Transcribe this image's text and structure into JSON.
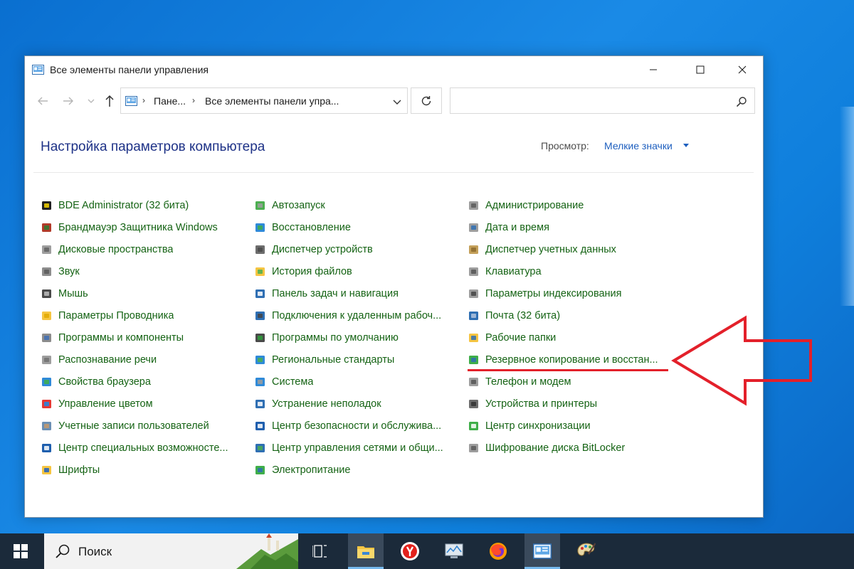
{
  "window": {
    "title": "Все элементы панели управления"
  },
  "address": {
    "crumbs": [
      "Пане...",
      "Все элементы панели упра..."
    ]
  },
  "search": {
    "placeholder": ""
  },
  "header": {
    "title": "Настройка параметров компьютера",
    "view_label": "Просмотр:",
    "view_value": "Мелкие значки"
  },
  "columns": [
    [
      {
        "label": "BDE Administrator (32 бита)",
        "icon": "bde-admin-icon"
      },
      {
        "label": "Брандмауэр Защитника Windows",
        "icon": "firewall-icon"
      },
      {
        "label": "Дисковые пространства",
        "icon": "storage-spaces-icon"
      },
      {
        "label": "Звук",
        "icon": "sound-icon"
      },
      {
        "label": "Мышь",
        "icon": "mouse-icon"
      },
      {
        "label": "Параметры Проводника",
        "icon": "explorer-options-icon"
      },
      {
        "label": "Программы и компоненты",
        "icon": "programs-icon"
      },
      {
        "label": "Распознавание речи",
        "icon": "microphone-icon"
      },
      {
        "label": "Свойства браузера",
        "icon": "internet-options-icon"
      },
      {
        "label": "Управление цветом",
        "icon": "color-management-icon"
      },
      {
        "label": "Учетные записи пользователей",
        "icon": "user-accounts-icon"
      },
      {
        "label": "Центр специальных возможносте...",
        "icon": "ease-of-access-icon"
      },
      {
        "label": "Шрифты",
        "icon": "fonts-icon"
      }
    ],
    [
      {
        "label": "Автозапуск",
        "icon": "autoplay-icon"
      },
      {
        "label": "Восстановление",
        "icon": "recovery-icon"
      },
      {
        "label": "Диспетчер устройств",
        "icon": "device-manager-icon"
      },
      {
        "label": "История файлов",
        "icon": "file-history-icon"
      },
      {
        "label": "Панель задач и навигация",
        "icon": "taskbar-icon"
      },
      {
        "label": "Подключения к удаленным рабоч...",
        "icon": "remote-connections-icon"
      },
      {
        "label": "Программы по умолчанию",
        "icon": "default-programs-icon"
      },
      {
        "label": "Региональные стандарты",
        "icon": "region-icon"
      },
      {
        "label": "Система",
        "icon": "system-icon"
      },
      {
        "label": "Устранение неполадок",
        "icon": "troubleshooting-icon"
      },
      {
        "label": "Центр безопасности и обслужива...",
        "icon": "security-flag-icon"
      },
      {
        "label": "Центр управления сетями и общи...",
        "icon": "network-center-icon"
      },
      {
        "label": "Электропитание",
        "icon": "power-options-icon"
      }
    ],
    [
      {
        "label": "Администрирование",
        "icon": "admin-tools-icon"
      },
      {
        "label": "Дата и время",
        "icon": "date-time-icon"
      },
      {
        "label": "Диспетчер учетных данных",
        "icon": "credential-manager-icon"
      },
      {
        "label": "Клавиатура",
        "icon": "keyboard-icon"
      },
      {
        "label": "Параметры индексирования",
        "icon": "indexing-icon"
      },
      {
        "label": "Почта (32 бита)",
        "icon": "mail-icon"
      },
      {
        "label": "Рабочие папки",
        "icon": "work-folders-icon"
      },
      {
        "label": "Резервное копирование и восстан...",
        "icon": "backup-restore-icon"
      },
      {
        "label": "Телефон и модем",
        "icon": "phone-modem-icon"
      },
      {
        "label": "Устройства и принтеры",
        "icon": "printer-icon"
      },
      {
        "label": "Центр синхронизации",
        "icon": "sync-center-icon"
      },
      {
        "label": "Шифрование диска BitLocker",
        "icon": "bitlocker-key-icon"
      }
    ]
  ],
  "taskbar": {
    "search_text": "Поиск",
    "apps": [
      "task-view-icon",
      "file-explorer-icon",
      "yandex-browser-icon",
      "system-monitor-icon",
      "firefox-icon",
      "control-panel-icon",
      "paint-icon"
    ]
  },
  "colors": {
    "link_green": "#156314",
    "title_blue": "#1e3287",
    "annotation_red": "#e3202a",
    "taskbar": "#1b2a3a"
  }
}
